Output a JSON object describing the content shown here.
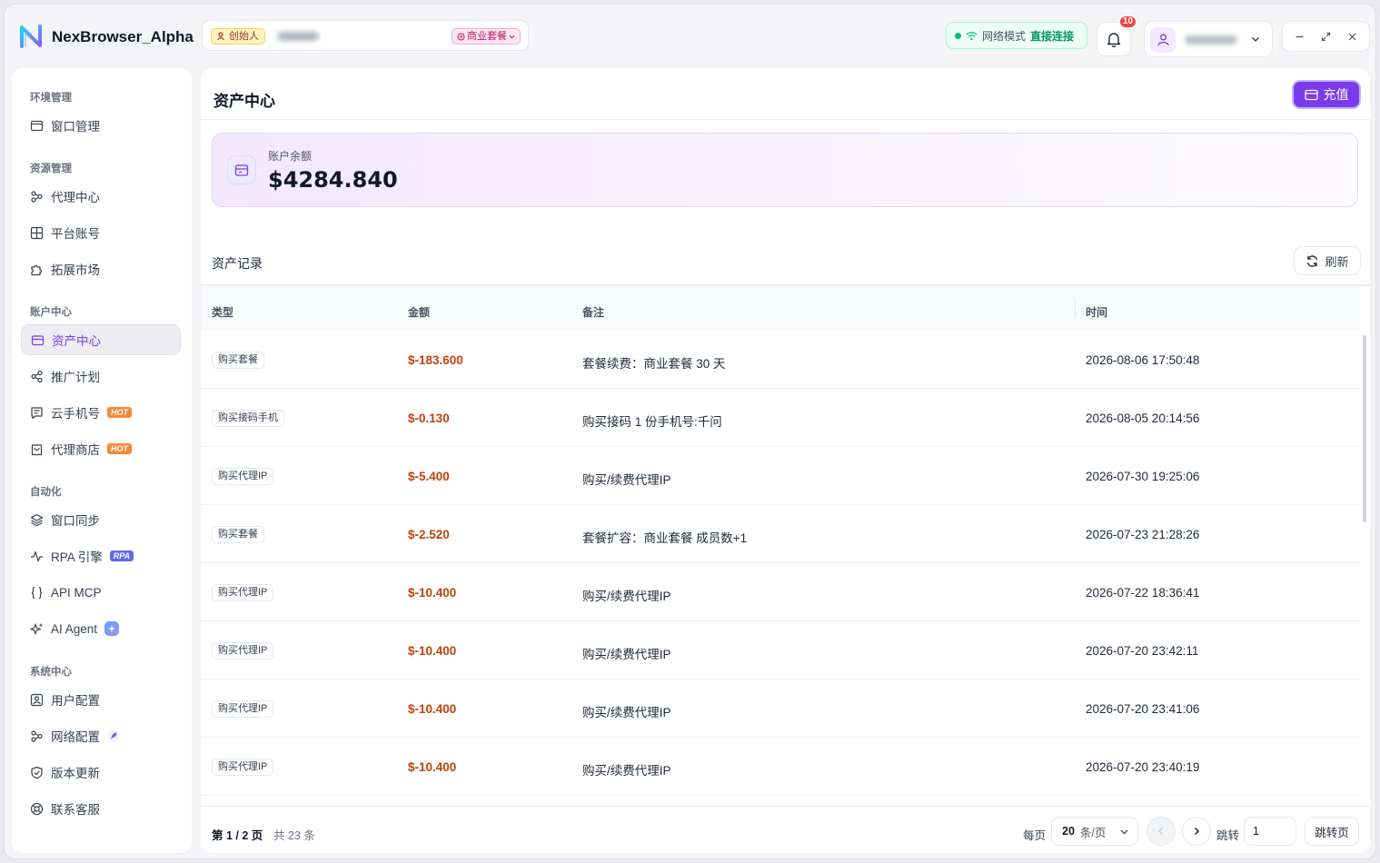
{
  "app": {
    "title": "NexBrowser_Alpha"
  },
  "header": {
    "role_badge": "创始人",
    "plan_badge": "商业套餐",
    "network": {
      "label": "网络模式",
      "value": "直接连接"
    },
    "notification_count": "10"
  },
  "sidebar": {
    "groups": [
      {
        "title": "环境管理",
        "items": [
          {
            "label": "窗口管理"
          }
        ]
      },
      {
        "title": "资源管理",
        "items": [
          {
            "label": "代理中心"
          },
          {
            "label": "平台账号"
          },
          {
            "label": "拓展市场"
          }
        ]
      },
      {
        "title": "账户中心",
        "items": [
          {
            "label": "资产中心"
          },
          {
            "label": "推广计划"
          },
          {
            "label": "云手机号",
            "tag": "HOT"
          },
          {
            "label": "代理商店",
            "tag": "HOT"
          }
        ]
      },
      {
        "title": "自动化",
        "items": [
          {
            "label": "窗口同步"
          },
          {
            "label": "RPA 引擎",
            "tag": "RPA"
          },
          {
            "label": "API MCP"
          },
          {
            "label": "AI Agent"
          }
        ]
      },
      {
        "title": "系统中心",
        "items": [
          {
            "label": "用户配置"
          },
          {
            "label": "网络配置"
          },
          {
            "label": "版本更新"
          },
          {
            "label": "联系客服"
          }
        ]
      }
    ],
    "active": "资产中心"
  },
  "main": {
    "title": "资产中心",
    "recharge_label": "充值",
    "balance": {
      "label": "账户余额",
      "value": "$4284.840"
    },
    "records_title": "资产记录",
    "refresh_label": "刷新",
    "columns": [
      "类型",
      "金额",
      "备注",
      "时间"
    ],
    "rows": [
      {
        "type": "购买套餐",
        "amount": "$-183.600",
        "note": "套餐续费：商业套餐 30 天",
        "time": "2026-08-06 17:50:48"
      },
      {
        "type": "购买接码手机",
        "amount": "$-0.130",
        "note": "购买接码 1 份手机号:千问",
        "time": "2026-08-05 20:14:56"
      },
      {
        "type": "购买代理IP",
        "amount": "$-5.400",
        "note": "购买/续费代理IP",
        "time": "2026-07-30 19:25:06"
      },
      {
        "type": "购买套餐",
        "amount": "$-2.520",
        "note": "套餐扩容：商业套餐 成员数+1",
        "time": "2026-07-23 21:28:26"
      },
      {
        "type": "购买代理IP",
        "amount": "$-10.400",
        "note": "购买/续费代理IP",
        "time": "2026-07-22 18:36:41"
      },
      {
        "type": "购买代理IP",
        "amount": "$-10.400",
        "note": "购买/续费代理IP",
        "time": "2026-07-20 23:42:11"
      },
      {
        "type": "购买代理IP",
        "amount": "$-10.400",
        "note": "购买/续费代理IP",
        "time": "2026-07-20 23:41:06"
      },
      {
        "type": "购买代理IP",
        "amount": "$-10.400",
        "note": "购买/续费代理IP",
        "time": "2026-07-20 23:40:19"
      }
    ],
    "pagination": {
      "page_info": "第 1 / 2 页",
      "total_info": "共 23 条",
      "per_page_label": "每页",
      "per_page_value": "20",
      "per_page_unit": "条/页",
      "jump_label": "跳转",
      "jump_value": "1",
      "jump_button": "跳转页"
    }
  }
}
